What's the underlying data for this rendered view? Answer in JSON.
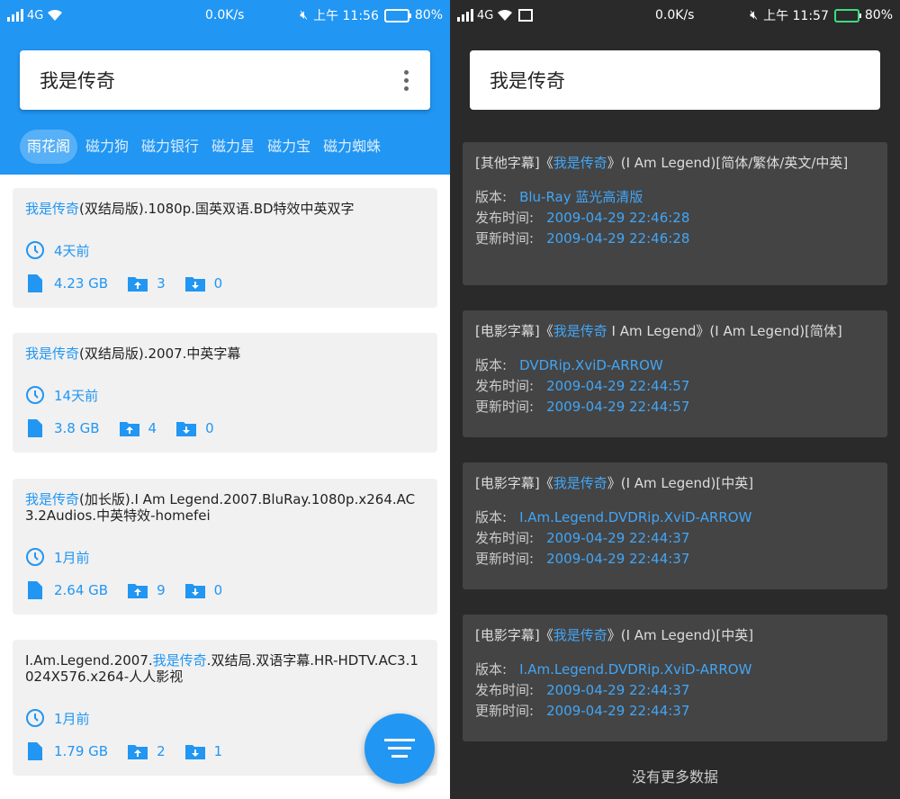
{
  "left": {
    "status": {
      "net": "4G",
      "speed": "0.0K/s",
      "time": "上午 11:56",
      "battery_pct": "80%",
      "battery_level": 0.8
    },
    "search": {
      "query": "我是传奇"
    },
    "tabs": [
      "雨花阁",
      "磁力狗",
      "磁力银行",
      "磁力星",
      "磁力宝",
      "磁力蜘蛛"
    ],
    "active_tab": 0,
    "results": [
      {
        "title_highlight": "我是传奇",
        "title_rest": "(双结局版).1080p.国英双语.BD特效中英双字",
        "title_prefix": "",
        "age": "4天前",
        "size": "4.23 GB",
        "seeds": "3",
        "peers": "0"
      },
      {
        "title_highlight": "我是传奇",
        "title_rest": "(双结局版).2007.中英字幕",
        "title_prefix": "",
        "age": "14天前",
        "size": "3.8 GB",
        "seeds": "4",
        "peers": "0"
      },
      {
        "title_highlight": "我是传奇",
        "title_rest": "(加长版).I Am Legend.2007.BluRay.1080p.x264.AC3.2Audios.中英特效-homefei",
        "title_prefix": "",
        "age": "1月前",
        "size": "2.64 GB",
        "seeds": "9",
        "peers": "0"
      },
      {
        "title_prefix": "I.Am.Legend.2007.",
        "title_highlight": "我是传奇",
        "title_rest": ".双结局.双语字幕.HR-HDTV.AC3.1024X576.x264-人人影视",
        "age": "1月前",
        "size": "1.79 GB",
        "seeds": "2",
        "peers": "1"
      }
    ]
  },
  "right": {
    "status": {
      "net": "4G",
      "speed": "0.0K/s",
      "time": "上午 11:57",
      "battery_pct": "80%",
      "battery_level": 0.8
    },
    "search": {
      "query": "我是传奇"
    },
    "labels": {
      "version": "版本:",
      "published": "发布时间:",
      "updated": "更新时间:"
    },
    "subtitles": [
      {
        "prefix": "[其他字幕]《",
        "highlight": "我是传奇",
        "suffix": "》(I Am Legend)[简体/繁体/英文/中英]",
        "version": "Blu-Ray 蓝光高清版",
        "published": "2009-04-29 22:46:28",
        "updated": "2009-04-29 22:46:28"
      },
      {
        "prefix": "[电影字幕]《",
        "highlight": "我是传奇",
        "suffix": " I Am Legend》(I Am Legend)[简体]",
        "version": "DVDRip.XviD-ARROW",
        "published": "2009-04-29 22:44:57",
        "updated": "2009-04-29 22:44:57"
      },
      {
        "prefix": "[电影字幕]《",
        "highlight": "我是传奇",
        "suffix": "》(I Am Legend)[中英]",
        "version": "I.Am.Legend.DVDRip.XviD-ARROW",
        "published": "2009-04-29 22:44:37",
        "updated": "2009-04-29 22:44:37"
      },
      {
        "prefix": "[电影字幕]《",
        "highlight": "我是传奇",
        "suffix": "》(I Am Legend)[中英]",
        "version": "I.Am.Legend.DVDRip.XviD-ARROW",
        "published": "2009-04-29 22:44:37",
        "updated": "2009-04-29 22:44:37"
      }
    ],
    "footer": "没有更多数据"
  },
  "icons": {
    "clock": "clock-icon",
    "file": "file-icon",
    "upload": "upload-folder-icon",
    "download": "download-folder-icon",
    "filter": "filter-icon",
    "menu": "more-vert-icon"
  },
  "colors": {
    "primary": "#2196f3",
    "dark_bg": "#2a2a2a",
    "dark_card": "#444444",
    "link": "#42a5f5"
  }
}
